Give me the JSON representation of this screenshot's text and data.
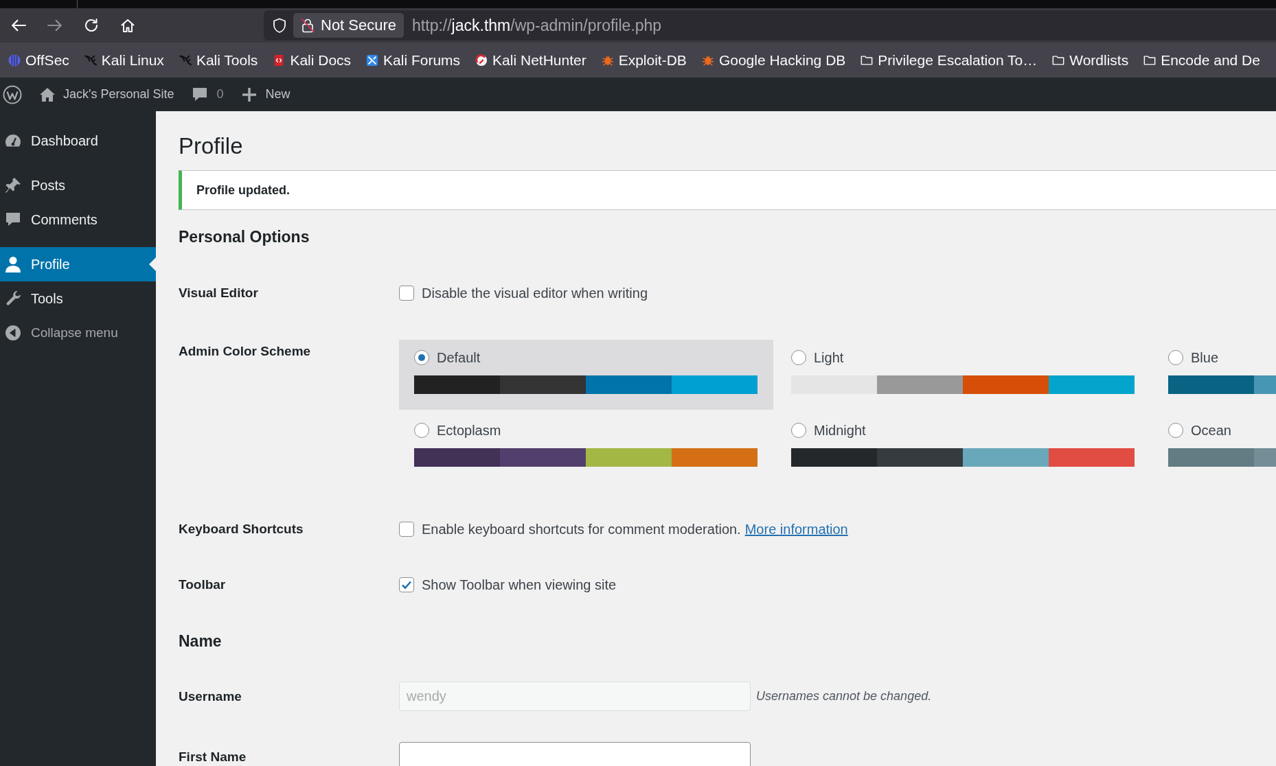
{
  "browser": {
    "nav_buttons": [
      {
        "kind": "back",
        "disabled": false
      },
      {
        "kind": "forward",
        "disabled": true
      },
      {
        "kind": "reload",
        "disabled": false
      },
      {
        "kind": "home",
        "disabled": false
      }
    ],
    "address_bar": {
      "security_label": "Not Secure",
      "url": {
        "scheme": "http://",
        "host": "jack.thm",
        "path": "/wp-admin/profile.php"
      }
    },
    "bookmarks": [
      {
        "label": "OffSec",
        "kind": "orb"
      },
      {
        "label": "Kali Linux",
        "kind": "dragon"
      },
      {
        "label": "Kali Tools",
        "kind": "dragon"
      },
      {
        "label": "Kali Docs",
        "kind": "book"
      },
      {
        "label": "Kali Forums",
        "kind": "tile"
      },
      {
        "label": "Kali NetHunter",
        "kind": "arc"
      },
      {
        "label": "Exploit-DB",
        "kind": "bug"
      },
      {
        "label": "Google Hacking DB",
        "kind": "bug"
      },
      {
        "label": "Privilege Escalation To…",
        "kind": "folder"
      },
      {
        "label": "Wordlists",
        "kind": "folder"
      },
      {
        "label": "Encode and De",
        "kind": "folder"
      }
    ]
  },
  "admin_bar": {
    "site_name": "Jack's Personal Site",
    "comment_count": "0",
    "new_label": "New"
  },
  "sidebar": {
    "groups": [
      [
        {
          "label": "Dashboard",
          "kind": "dashboard",
          "selected": false
        }
      ],
      [
        {
          "label": "Posts",
          "kind": "posts",
          "selected": false
        },
        {
          "label": "Comments",
          "kind": "comments",
          "selected": false
        }
      ],
      [
        {
          "label": "Profile",
          "kind": "profile",
          "selected": true
        },
        {
          "label": "Tools",
          "kind": "tools",
          "selected": false
        }
      ]
    ],
    "collapse_label": "Collapse menu"
  },
  "page": {
    "title": "Profile",
    "notice": "Profile updated.",
    "sections": [
      {
        "heading": "Personal Options",
        "rows": [
          {
            "kind": "checkbox",
            "label": "Visual Editor",
            "text": "Disable the visual editor when writing",
            "checked": false
          },
          {
            "kind": "color_scheme",
            "label": "Admin Color Scheme",
            "options": [
              {
                "name": "Default",
                "selected": true,
                "swatches": [
                  {
                    "color": "#222222"
                  },
                  {
                    "color": "#333333"
                  },
                  {
                    "color": "#0073aa"
                  },
                  {
                    "color": "#00a0d2"
                  }
                ]
              },
              {
                "name": "Light",
                "selected": false,
                "swatches": [
                  {
                    "color": "#e5e5e5"
                  },
                  {
                    "color": "#999999"
                  },
                  {
                    "color": "#d64e07"
                  },
                  {
                    "color": "#04a4cc"
                  }
                ]
              },
              {
                "name": "Blue",
                "selected": false,
                "swatches": [
                  {
                    "color": "#096484"
                  },
                  {
                    "color": "#4796b3"
                  }
                ]
              },
              {
                "name": "Ectoplasm",
                "selected": false,
                "swatches": [
                  {
                    "color": "#413256"
                  },
                  {
                    "color": "#523f6d"
                  },
                  {
                    "color": "#a3b745"
                  },
                  {
                    "color": "#d46f15"
                  }
                ]
              },
              {
                "name": "Midnight",
                "selected": false,
                "swatches": [
                  {
                    "color": "#25282b"
                  },
                  {
                    "color": "#363b3f"
                  },
                  {
                    "color": "#69a8bb"
                  },
                  {
                    "color": "#e14d43"
                  }
                ]
              },
              {
                "name": "Ocean",
                "selected": false,
                "swatches": [
                  {
                    "color": "#627c83"
                  },
                  {
                    "color": "#738e96"
                  }
                ]
              }
            ]
          },
          {
            "kind": "checkbox",
            "label": "Keyboard Shortcuts",
            "text": "Enable keyboard shortcuts for comment moderation.",
            "link": "More information",
            "checked": false
          },
          {
            "kind": "checkbox",
            "label": "Toolbar",
            "text": "Show Toolbar when viewing site",
            "checked": true
          }
        ]
      },
      {
        "heading": "Name",
        "rows": [
          {
            "kind": "text_field",
            "label": "Username",
            "value": "wendy",
            "disabled": true,
            "description": "Usernames cannot be changed."
          },
          {
            "kind": "text_field",
            "label": "First Name",
            "disabled": false
          }
        ]
      }
    ]
  }
}
